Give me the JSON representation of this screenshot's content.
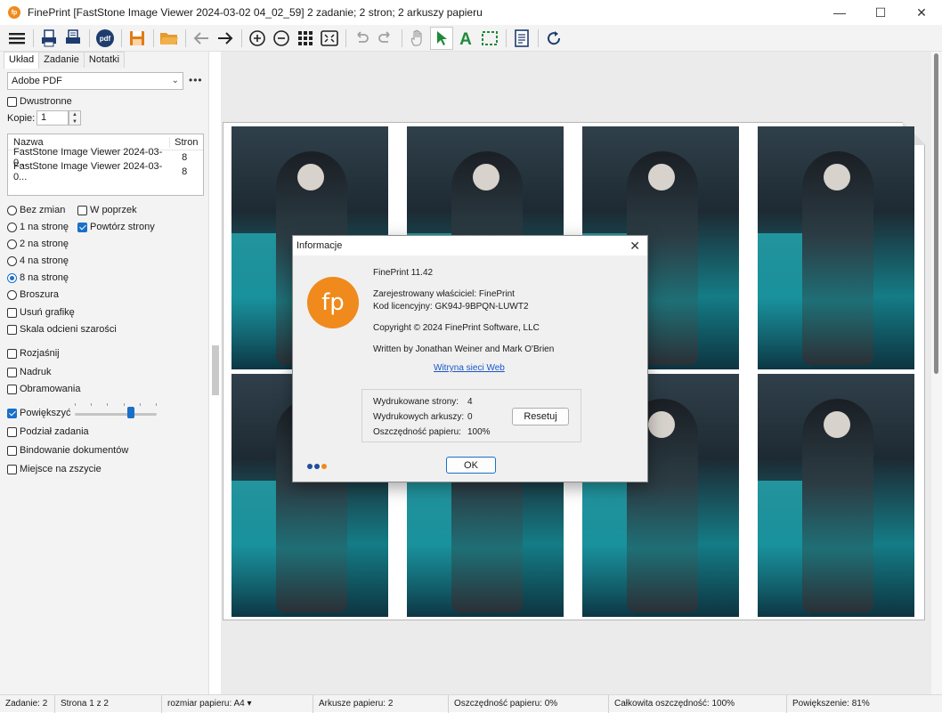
{
  "window": {
    "title": "FinePrint [FastStone Image Viewer 2024-03-02 04_02_59] 2 zadanie; 2 stron; 2 arkuszy papieru",
    "app_icon": "fp",
    "controls": {
      "minimize": "—",
      "maximize": "☐",
      "close": "✕"
    }
  },
  "toolbar": {
    "items": [
      "menu-icon",
      "print-icon",
      "print-settings-icon",
      "pdf-icon",
      "save-icon",
      "open-folder-icon",
      "back-arrow-icon",
      "forward-arrow-icon",
      "zoom-in-icon",
      "zoom-out-icon",
      "grid-icon",
      "fit-icon",
      "undo-icon",
      "redo-icon",
      "hand-icon",
      "pointer-icon",
      "text-icon",
      "select-rect-icon",
      "page-setup-icon",
      "refresh-icon"
    ],
    "pdf_label": "pdf",
    "text_label": "A"
  },
  "left": {
    "tabs": [
      "Układ",
      "Zadanie",
      "Notatki"
    ],
    "printer": "Adobe PDF",
    "more": "•••",
    "duplex_label": "Dwustronne",
    "copies_label": "Kopie:",
    "copies_value": "1",
    "joblist": {
      "headers": [
        "Nazwa",
        "Stron"
      ],
      "rows": [
        {
          "name": "FastStone Image Viewer 2024-03-0...",
          "pages": "8"
        },
        {
          "name": "FastStone Image Viewer 2024-03-0...",
          "pages": "8"
        }
      ]
    },
    "layout_options": [
      {
        "label": "Bez zmian",
        "selected": false
      },
      {
        "label": "1 na stronę",
        "selected": false
      },
      {
        "label": "2 na stronę",
        "selected": false
      },
      {
        "label": "4 na stronę",
        "selected": false
      },
      {
        "label": "8 na stronę",
        "selected": true
      },
      {
        "label": "Broszura",
        "selected": false
      }
    ],
    "across_label": "W poprzek",
    "repeat_label": "Powtórz strony",
    "options": [
      {
        "label": "Usuń grafikę",
        "checked": false
      },
      {
        "label": "Skala odcieni szarości",
        "checked": false
      },
      {
        "label": "Rozjaśnij",
        "checked": false
      },
      {
        "label": "Nadruk",
        "checked": false
      },
      {
        "label": "Obramowania",
        "checked": false
      },
      {
        "label": "Powiększyć",
        "checked": true
      },
      {
        "label": "Podział zadania",
        "checked": false
      },
      {
        "label": "Bindowanie dokumentów",
        "checked": false
      },
      {
        "label": "Miejsce na zszycie",
        "checked": false
      }
    ],
    "zoom_slider_level": 0.68
  },
  "dialog": {
    "title": "Informacje",
    "close": "✕",
    "logo_text": "fp",
    "version": "FinePrint 11.42",
    "owner": "Zarejestrowany właściciel:   FinePrint",
    "license": "Kod licencyjny:   GK94J-9BPQN-LUWT2",
    "copyright": "Copyright © 2024 FinePrint Software, LLC",
    "authors": "Written by Jonathan Weiner and Mark O'Brien",
    "website": "Witryna sieci Web",
    "stats": [
      {
        "label": "Wydrukowane strony:",
        "value": "4"
      },
      {
        "label": "Wydrukowych arkuszy:",
        "value": "0"
      },
      {
        "label": "Oszczędność papieru:",
        "value": "100%"
      }
    ],
    "reset_label": "Resetuj",
    "ok_label": "OK",
    "dot_colors": [
      "#1f4e9c",
      "#1f4e9c",
      "#f08a1c"
    ]
  },
  "statusbar": {
    "jobs": "Zadanie: 2",
    "page": "Strona 1 z 2",
    "paper_size": "rozmiar papieru: A4",
    "sheets": "Arkusze papieru: 2",
    "savings": "Oszczędność papieru: 0%",
    "total_savings": "Całkowita oszczędność: 100%",
    "zoom": "Powiększenie: 81%"
  },
  "colors": {
    "accent": "#1a6fc9",
    "brand": "#f08a1c"
  }
}
